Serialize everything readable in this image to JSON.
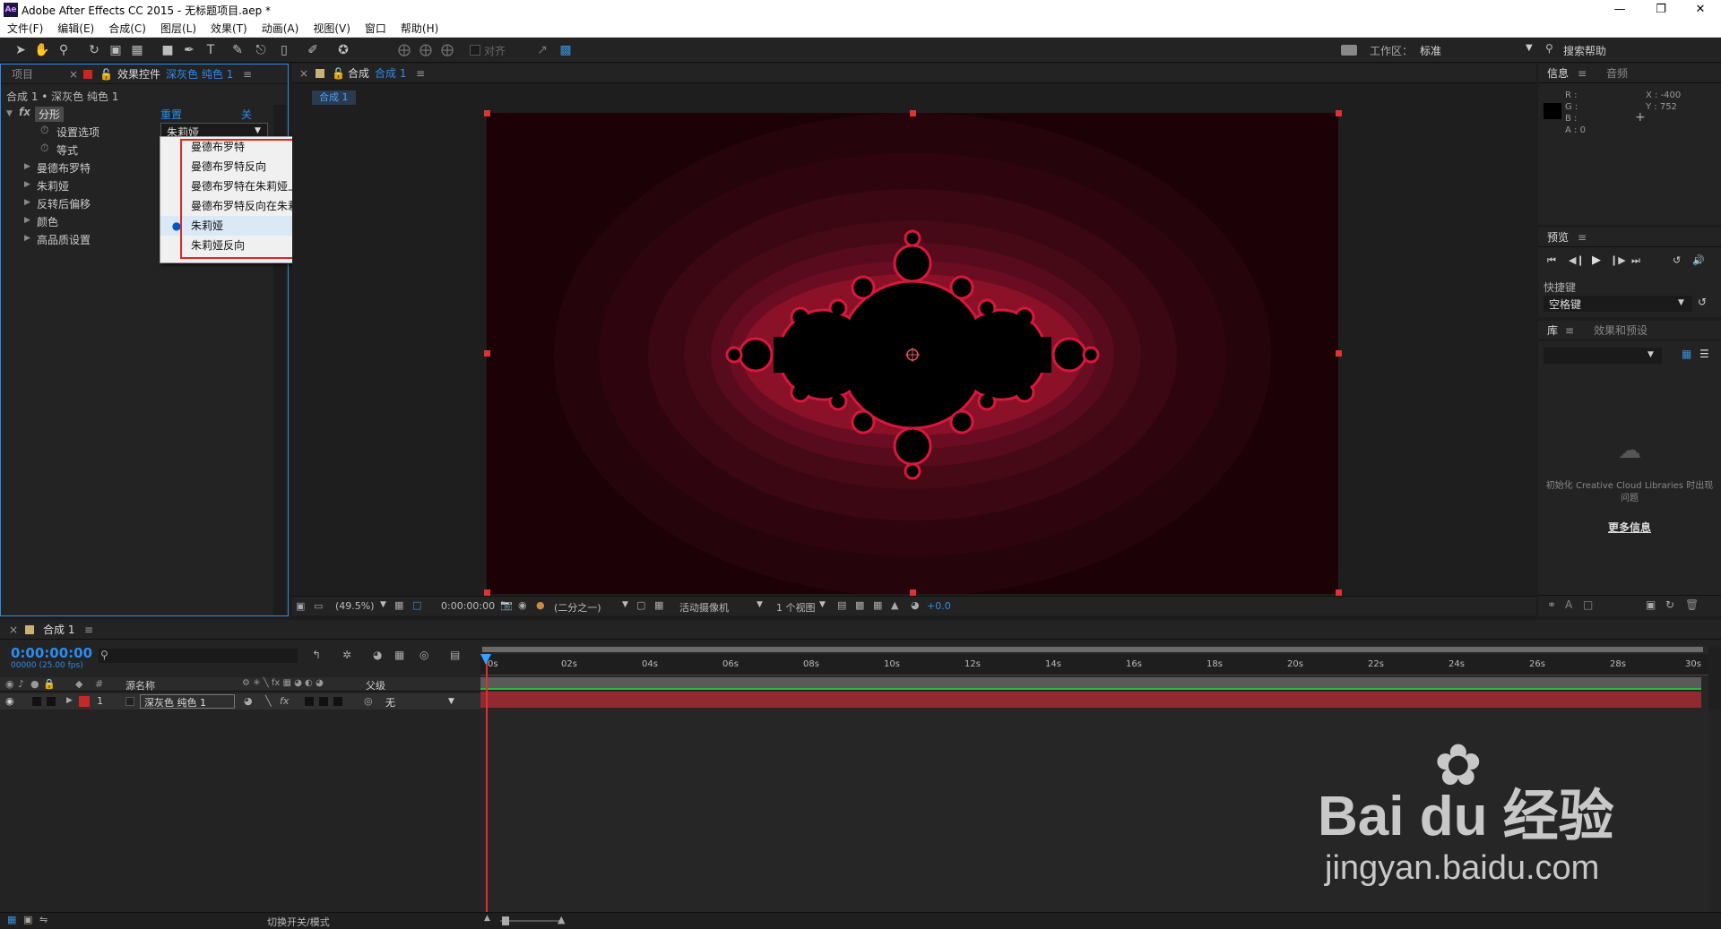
{
  "app": {
    "title": "Adobe After Effects CC 2015 - 无标题项目.aep *",
    "logo": "Ae"
  },
  "menu": [
    "文件(F)",
    "编辑(E)",
    "合成(C)",
    "图层(L)",
    "效果(T)",
    "动画(A)",
    "视图(V)",
    "窗口",
    "帮助(H)"
  ],
  "toolbar": {
    "align_label": "对齐",
    "workspace_label": "工作区：",
    "workspace_value": "标准",
    "search_help": "搜索帮助"
  },
  "left_panel": {
    "tab_project": "项目",
    "tab_effects": "效果控件",
    "tab_effects_layer": "深灰色 纯色 1",
    "breadcrumb": "合成 1 • 深灰色 纯色 1",
    "effect_name": "分形",
    "reset_label": "重置",
    "about_label": "关于...",
    "props": [
      {
        "label": "设置选项",
        "type": "stopwatch"
      },
      {
        "label": "等式",
        "type": "stopwatch"
      },
      {
        "label": "曼德布罗特",
        "type": "group"
      },
      {
        "label": "朱莉娅",
        "type": "group"
      },
      {
        "label": "反转后偏移",
        "type": "group"
      },
      {
        "label": "颜色",
        "type": "group"
      },
      {
        "label": "高品质设置",
        "type": "group"
      }
    ],
    "dropdown_value": "朱莉娅"
  },
  "dropdown_menu": {
    "options": [
      "曼德布罗特",
      "曼德布罗特反向",
      "曼德布罗特在朱莉娅上",
      "曼德布罗特反向在朱莉娅上",
      "朱莉娅",
      "朱莉娅反向"
    ],
    "selected_index": 4
  },
  "comp_panel": {
    "tab_label": "合成",
    "tab_comp": "合成 1",
    "comp_subtab": "合成 1",
    "zoom": "(49.5%)",
    "timecode": "0:00:00:00",
    "resolution": "(二分之一)",
    "camera": "活动摄像机",
    "views": "1 个视图",
    "exposure": "+0.0"
  },
  "info_panel": {
    "tab_info": "信息",
    "tab_audio": "音频",
    "r": "R :",
    "g": "G :",
    "b": "B :",
    "a": "A : 0",
    "x": "X : -400",
    "y": "Y : 752"
  },
  "preview_panel": {
    "title": "预览",
    "shortcut_label": "快捷键",
    "shortcut_value": "空格键"
  },
  "library_panel": {
    "tab_library": "库",
    "tab_effects": "效果和预设",
    "message": "初始化 Creative Cloud Libraries 时出现问题",
    "more_info": "更多信息"
  },
  "timeline": {
    "tab": "合成 1",
    "timecode": "0:00:00:00",
    "fps": "00000 (25.00 fps)",
    "col_source": "源名称",
    "col_parent": "父级",
    "col_num": "#",
    "layer_num": "1",
    "layer_name": "深灰色 纯色 1",
    "parent_value": "无",
    "ruler": [
      "0s",
      "02s",
      "04s",
      "06s",
      "08s",
      "10s",
      "12s",
      "14s",
      "16s",
      "18s",
      "20s",
      "22s",
      "24s",
      "26s",
      "28s",
      "30s"
    ],
    "toggle_label": "切换开关/模式"
  },
  "watermark": {
    "brand": "Bai du 经验",
    "url": "jingyan.baidu.com"
  }
}
